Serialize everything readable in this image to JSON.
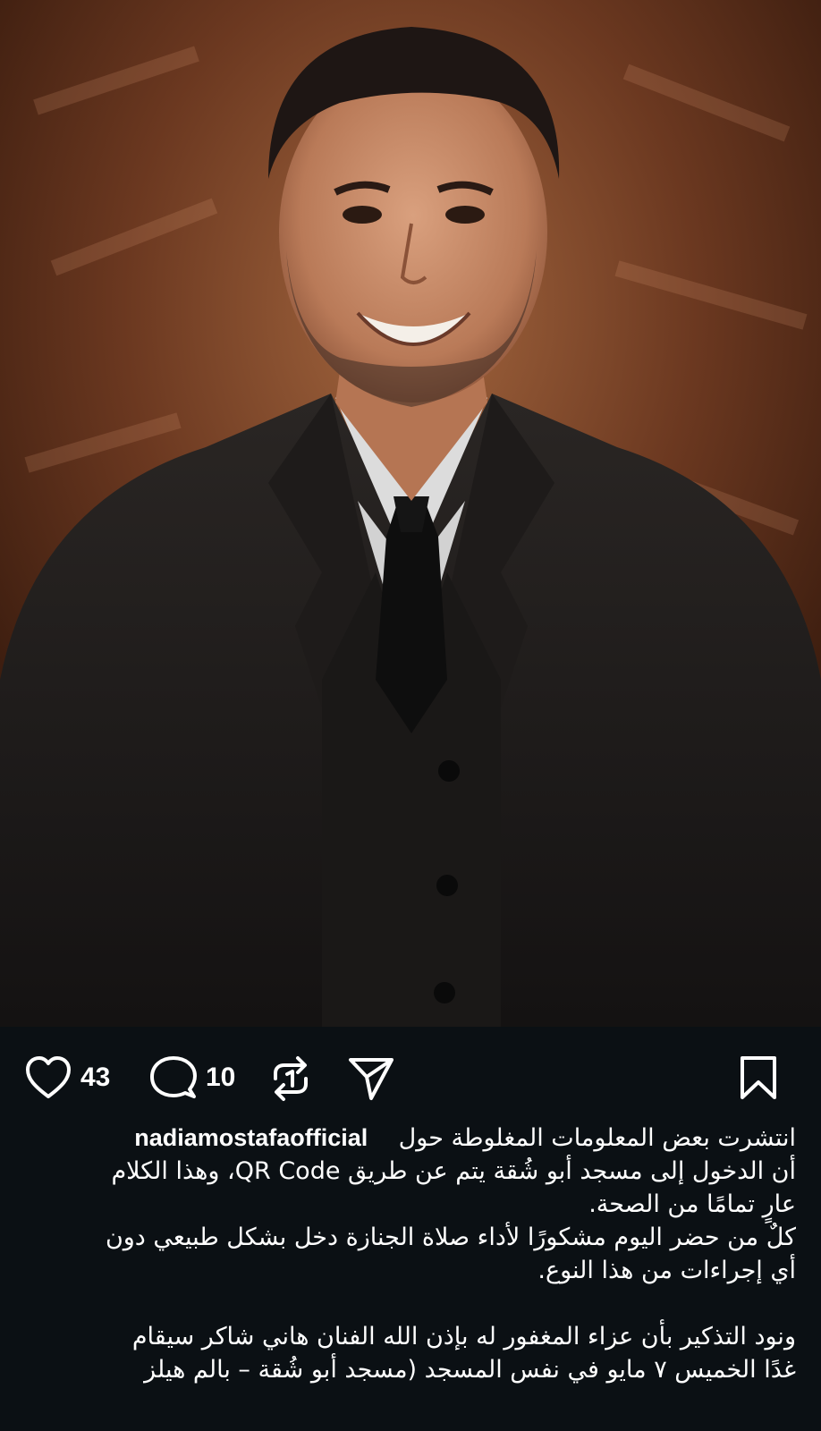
{
  "post": {
    "image_icon": "portrait-photo",
    "actions": {
      "like_icon": "heart-icon",
      "like_count": "43",
      "comment_icon": "comment-icon",
      "comment_count": "10",
      "repost_icon": "repost-icon",
      "share_icon": "send-icon",
      "save_icon": "bookmark-icon"
    },
    "caption": {
      "username": "nadiamostafaofficial",
      "line1": "انتشرت بعض المعلومات المغلوطة حول",
      "line2": "أن الدخول إلى مسجد أبو شُقة يتم عن طريق QR Code، وهذا الكلام",
      "line3": "عارٍ تمامًا من الصحة.",
      "line4": "كلٌ من حضر اليوم مشكورًا لأداء صلاة الجنازة دخل بشكل طبيعي دون",
      "line5": "أي إجراءات من هذا النوع.",
      "line6": "ونود التذكير بأن عزاء المغفور له بإذن الله الفنان هاني شاكر سيقام",
      "line7": "غدًا الخميس ٧ مايو في نفس المسجد (مسجد أبو شُقة – بالم هيلز"
    }
  },
  "colors": {
    "background": "#0b1014",
    "text": "#ffffff"
  }
}
